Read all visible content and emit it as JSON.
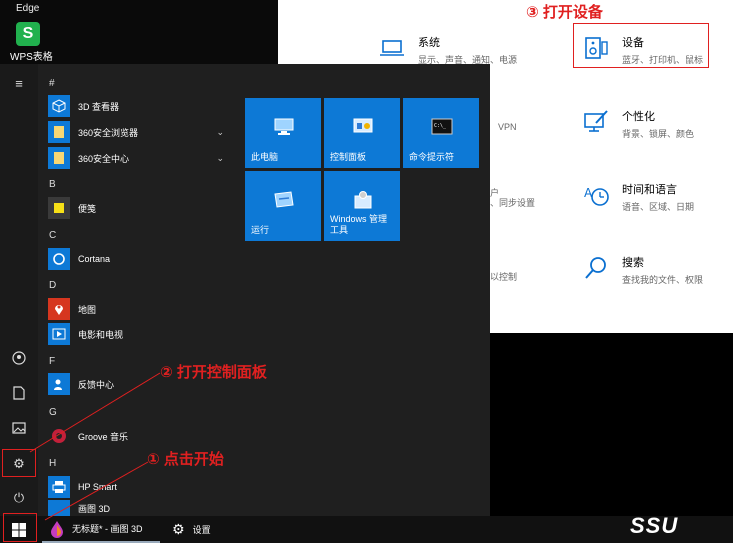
{
  "desktop": {
    "edge_label": "Edge",
    "wps_icon_letter": "S",
    "wps_label": "WPS表格"
  },
  "settings": {
    "items": [
      {
        "title": "系统",
        "subtitle": "显示、声音、通知、电源"
      },
      {
        "title": "设备",
        "subtitle": "蓝牙、打印机、鼠标"
      },
      {
        "title": "个性化",
        "subtitle": "背景、锁屏、颜色"
      },
      {
        "title": "时间和语言",
        "subtitle": "语音、区域、日期"
      },
      {
        "title": "搜索",
        "subtitle": "查找我的文件、权限"
      }
    ],
    "fragments": [
      "VPN",
      "户",
      "、同步设置",
      "以控制"
    ]
  },
  "start_menu": {
    "letters": {
      "hash": "#",
      "b": "B",
      "c": "C",
      "d": "D",
      "f": "F",
      "g": "G",
      "h": "H"
    },
    "apps": [
      {
        "name": "3D 查看器"
      },
      {
        "name": "360安全浏览器"
      },
      {
        "name": "360安全中心"
      },
      {
        "name": "便笺"
      },
      {
        "name": "Cortana"
      },
      {
        "name": "地图"
      },
      {
        "name": "电影和电视"
      },
      {
        "name": "反馈中心"
      },
      {
        "name": "Groove 音乐"
      },
      {
        "name": "HP Smart"
      },
      {
        "name": "画图 3D"
      }
    ],
    "tiles": [
      {
        "label": "此电脑"
      },
      {
        "label": "控制面板"
      },
      {
        "label": "命令提示符"
      },
      {
        "label": "运行"
      },
      {
        "label": "Windows 管理\n工具"
      }
    ]
  },
  "taskbar": {
    "paint_label": "无标题* - 画图 3D",
    "settings_label": "设置"
  },
  "annotations": {
    "step1": "① 点击开始",
    "step2": "② 打开控制面板",
    "step3": "③ 打开设备"
  },
  "brand": "SSU"
}
